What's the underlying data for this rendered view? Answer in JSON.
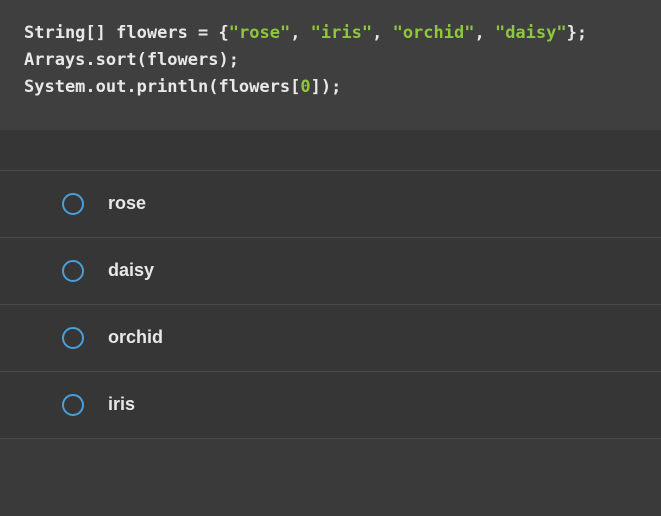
{
  "code": {
    "tokens_line1": [
      {
        "text": "String",
        "cls": "type"
      },
      {
        "text": "[]",
        "cls": "bracket"
      },
      {
        "text": " ",
        "cls": "keyword"
      },
      {
        "text": "flowers",
        "cls": "var"
      },
      {
        "text": " = {",
        "cls": "op"
      },
      {
        "text": "\"rose\"",
        "cls": "string"
      },
      {
        "text": ", ",
        "cls": "punct"
      },
      {
        "text": "\"iris\"",
        "cls": "string"
      },
      {
        "text": ", ",
        "cls": "punct"
      },
      {
        "text": "\"orchid\"",
        "cls": "string"
      },
      {
        "text": ", ",
        "cls": "punct"
      },
      {
        "text": "\"daisy\"",
        "cls": "string"
      },
      {
        "text": "};",
        "cls": "punct"
      }
    ],
    "tokens_line2": [
      {
        "text": "Arrays.sort(flowers);",
        "cls": "method"
      }
    ],
    "tokens_line3": [
      {
        "text": "System.out.println(flowers[",
        "cls": "method"
      },
      {
        "text": "0",
        "cls": "num"
      },
      {
        "text": "]);",
        "cls": "method"
      }
    ]
  },
  "options": [
    {
      "label": "rose"
    },
    {
      "label": "daisy"
    },
    {
      "label": "orchid"
    },
    {
      "label": "iris"
    }
  ]
}
